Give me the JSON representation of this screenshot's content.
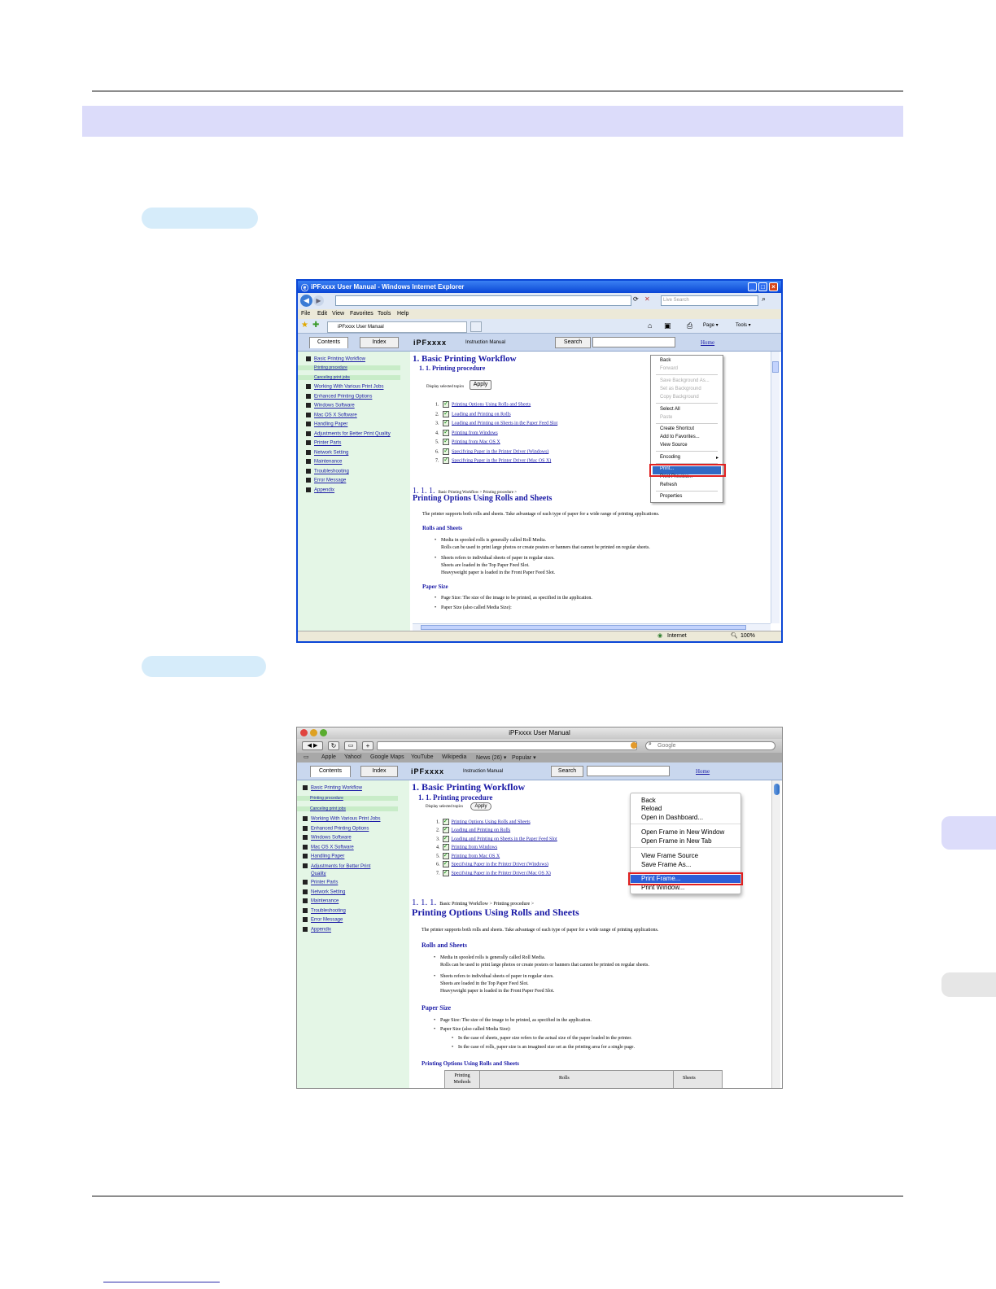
{
  "ie_window": {
    "title": "iPFxxxx User Manual - Windows Internet Explorer",
    "search_placeholder": "Live Search",
    "menu": [
      "File",
      "Edit",
      "View",
      "Favorites",
      "Tools",
      "Help"
    ],
    "tab_title": "iPFxxxx User Manual",
    "toolbar_page": "Page ▾",
    "toolbar_tools": "Tools ▾",
    "status_zone": "Internet",
    "status_zoom": "100%",
    "context_menu": {
      "items": [
        "Back",
        "Forward",
        "Save Background As...",
        "Set as Background",
        "Copy Background",
        "Select All",
        "Paste",
        "Create Shortcut",
        "Add to Favorites...",
        "View Source",
        "Encoding",
        "Print...",
        "Print Preview...",
        "Refresh",
        "Properties"
      ],
      "highlighted": "Print..."
    }
  },
  "mac_window": {
    "title": "iPFxxxx User Manual",
    "search_placeholder": "Google",
    "bookmarks": [
      "Apple",
      "Yahoo!",
      "Google Maps",
      "YouTube",
      "Wikipedia",
      "News (26) ▾",
      "Popular ▾"
    ],
    "context_menu": {
      "items": [
        "Back",
        "Reload",
        "Open in Dashboard...",
        "Open Frame in New Window",
        "Open Frame in New Tab",
        "View Frame Source",
        "Save Frame As...",
        "Print Frame...",
        "Print Window..."
      ],
      "highlighted": "Print Frame..."
    }
  },
  "manual": {
    "tab_contents": "Contents",
    "tab_index": "Index",
    "brand": "iPFxxxx",
    "subtitle": "Instruction Manual",
    "search_button": "Search",
    "home_link": "Home",
    "nav": [
      "Basic Printing Workflow",
      "Printing procedure",
      "Canceling print jobs",
      "Working With Various Print Jobs",
      "Enhanced Printing Options",
      "Windows Software",
      "Mac OS X Software",
      "Handling Paper",
      "Adjustments for Better Print Quality",
      "Printer Parts",
      "Network Setting",
      "Maintenance",
      "Troubleshooting",
      "Error Message",
      "Appendix"
    ],
    "mac_nav_adjust_line1": "Adjustments for Better Print",
    "mac_nav_adjust_line2": "Quality",
    "heading": "1. Basic Printing Workflow",
    "subheading": "1. 1. Printing procedure",
    "display_label": "Display selected topics",
    "apply": "Apply",
    "topics": [
      "Printing Options Using Rolls and Sheets",
      "Loading and Printing on Rolls",
      "Loading and Printing on Sheets in the Paper Feed Slot",
      "Printing from Windows",
      "Printing from Mac OS X",
      "Specifying Paper in the Printer Driver (Windows)",
      "Specifying Paper in the Printer Driver (Mac OS X)"
    ],
    "section_number": "1. 1. 1.",
    "breadcrumb": "Basic Printing Workflow > Printing procedure >",
    "section_title": "Printing Options Using Rolls and Sheets",
    "intro": "The printer supports both rolls and sheets. Take advantage of each type of paper for a wide range of printing applications.",
    "rolls_heading": "Rolls and Sheets",
    "rolls_b1_l1": "Media in spooled rolls is generally called Roll Media.",
    "rolls_b1_l2": "Rolls can be used to print large photos or create posters or banners that cannot be printed on regular sheets.",
    "rolls_b2_l1": "Sheets refers to individual sheets of paper in regular sizes.",
    "rolls_b2_l2": "Sheets are loaded in the Top Paper Feed Slot.",
    "rolls_b2_l3": "Heavyweight paper is loaded in the Front Paper Feed Slot.",
    "paper_heading": "Paper Size",
    "paper_b1": "Page Size: The size of the image to be printed, as specified in the application.",
    "paper_b2": "Paper Size (also called Media Size):",
    "paper_sub1": "In the case of sheets, paper size refers to the actual size of the paper loaded in the printer.",
    "paper_sub2": "In the case of rolls, paper size is an imagined size set as the printing area for a single page.",
    "table_heading": "Printing Options Using Rolls and Sheets",
    "table_headers": [
      "Printing Methods",
      "Rolls",
      "Sheets"
    ]
  },
  "colors": {
    "heading_band": "#dcdcfa",
    "step_pill": "#d6ecfa",
    "highlight_box": "#e02020",
    "link": "#1a1aa6",
    "sidebar": "#e4f6e6"
  }
}
